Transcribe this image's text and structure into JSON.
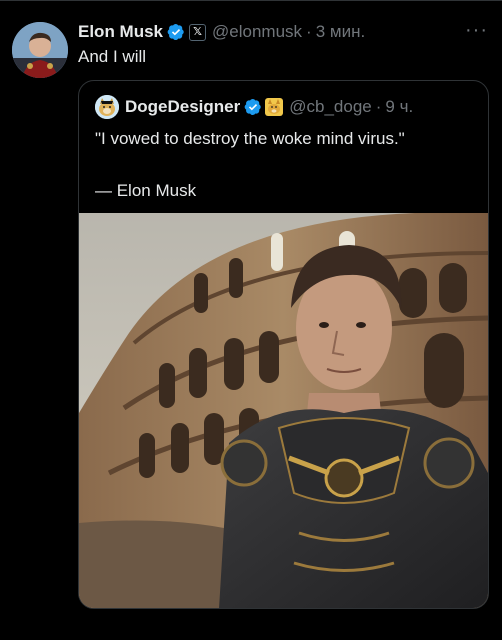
{
  "tweet": {
    "author_name": "Elon Musk",
    "badge_letter": "𝕏",
    "handle": "@elonmusk",
    "separator": "·",
    "time": "3 мин.",
    "more": "···",
    "text": "And I will"
  },
  "quote": {
    "author_name": "DogeDesigner",
    "handle": "@cb_doge",
    "separator": "·",
    "time": "9 ч.",
    "text": "\"I vowed to destroy the woke mind virus.\"",
    "attribution": "— Elon Musk"
  },
  "colors": {
    "background": "#000000",
    "text_primary": "#e7e9ea",
    "text_secondary": "#71767b",
    "verified_blue": "#1d9bf0",
    "border": "#2f3336"
  },
  "icons": {
    "verified": "verified-badge-icon",
    "affiliate": "x-affiliate-icon",
    "more": "more-options-icon",
    "doge_emoji": "doge-emoji-icon"
  }
}
